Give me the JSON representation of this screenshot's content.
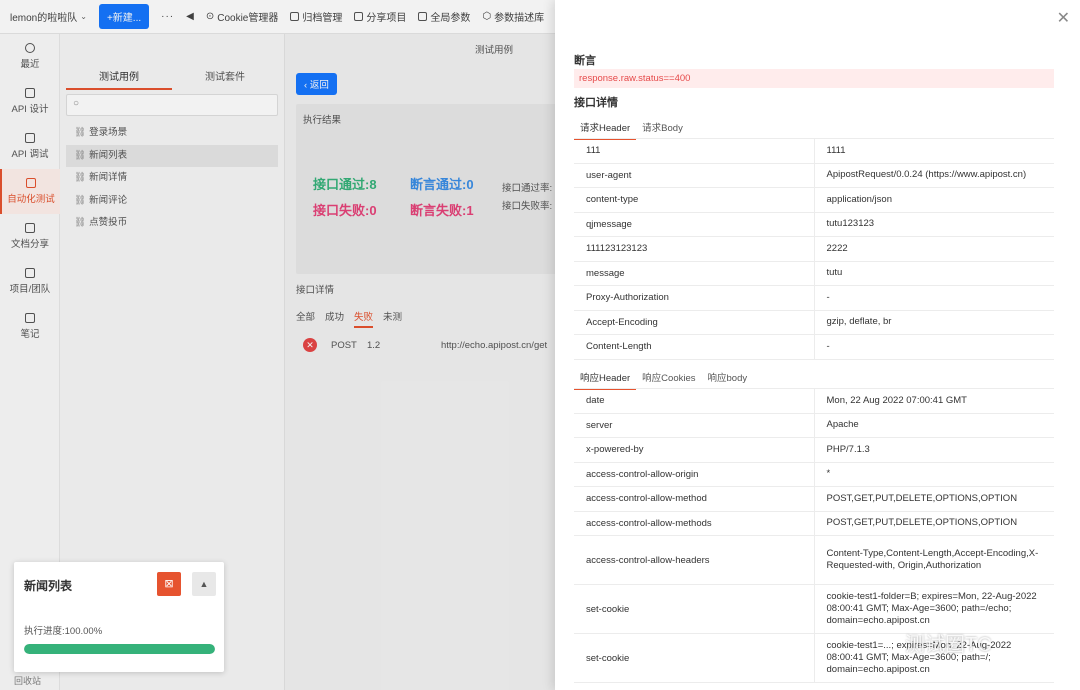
{
  "topbar": {
    "team": "lemon的啦啦队",
    "new_btn": "+新建...",
    "more": "···",
    "items": [
      "Cookie管理器",
      "归档管理",
      "分享项目",
      "全局参数",
      "参数描述库"
    ]
  },
  "nav": [
    {
      "label": "最近",
      "icon": "clock-icon"
    },
    {
      "label": "API 设计",
      "icon": "design-icon"
    },
    {
      "label": "API 调试",
      "icon": "debug-icon"
    },
    {
      "label": "自动化测试",
      "icon": "automation-icon"
    },
    {
      "label": "文档分享",
      "icon": "doc-icon"
    },
    {
      "label": "项目/团队",
      "icon": "project-icon"
    },
    {
      "label": "笔记",
      "icon": "note-icon"
    }
  ],
  "cases": {
    "tabs": [
      "测试用例",
      "测试套件"
    ],
    "items": [
      "登录场景",
      "新闻列表",
      "新闻详情",
      "新闻评论",
      "点赞投币"
    ]
  },
  "main": {
    "tab": "测试用例",
    "back": "返回",
    "result_title": "执行结果",
    "api_pass": "接口通过:8",
    "assert_pass": "断言通过:0",
    "api_fail": "接口失败:0",
    "assert_fail": "断言失败:1",
    "api_pass_rate": "接口通过率:",
    "api_fail_rate": "接口失败率:",
    "detail_title": "接口详情",
    "filters": [
      "全部",
      "成功",
      "失败",
      "未测"
    ],
    "row": {
      "method": "POST",
      "time": "1.2",
      "url": "http://echo.apipost.cn/get"
    }
  },
  "progress": {
    "title": "新闻列表",
    "label": "执行进度:100.00%",
    "value": 1.0
  },
  "bottom_text": "回收站",
  "drawer": {
    "assert_title": "断言",
    "assert_expr": "response.raw.status==400",
    "detail_title": "接口详情",
    "req_tabs": [
      "请求Header",
      "请求Body"
    ],
    "req_headers": [
      [
        "111",
        "1111"
      ],
      [
        "user-agent",
        "ApipostRequest/0.0.24 (https://www.apipost.cn)"
      ],
      [
        "content-type",
        "application/json"
      ],
      [
        "qjmessage",
        "tutu123123"
      ],
      [
        "111123123123",
        "2222"
      ],
      [
        "message",
        "tutu"
      ],
      [
        "Proxy-Authorization",
        "-"
      ],
      [
        "Accept-Encoding",
        "gzip, deflate, br"
      ],
      [
        "Content-Length",
        "-"
      ]
    ],
    "resp_tabs": [
      "响应Header",
      "响应Cookies",
      "响应body"
    ],
    "resp_headers": [
      [
        "date",
        "Mon, 22 Aug 2022 07:00:41 GMT"
      ],
      [
        "server",
        "Apache"
      ],
      [
        "x-powered-by",
        "PHP/7.1.3"
      ],
      [
        "access-control-allow-origin",
        "*"
      ],
      [
        "access-control-allow-method",
        "POST,GET,PUT,DELETE,OPTIONS,OPTION"
      ],
      [
        "access-control-allow-methods",
        "POST,GET,PUT,DELETE,OPTIONS,OPTION"
      ],
      [
        "access-control-allow-headers",
        "Content-Type,Content-Length,Accept-Encoding,X-Requested-with, Origin,Authorization"
      ],
      [
        "set-cookie",
        "cookie-test1-folder=B; expires=Mon, 22-Aug-2022 08:00:41 GMT; Max-Age=3600; path=/echo; domain=echo.apipost.cn"
      ],
      [
        "set-cookie",
        "cookie-test1=...; expires=Mon, 22-Aug-2022 08:00:41 GMT; Max-Age=3600; path=/; domain=echo.apipost.cn"
      ]
    ]
  },
  "watermark": "测试圈TC"
}
